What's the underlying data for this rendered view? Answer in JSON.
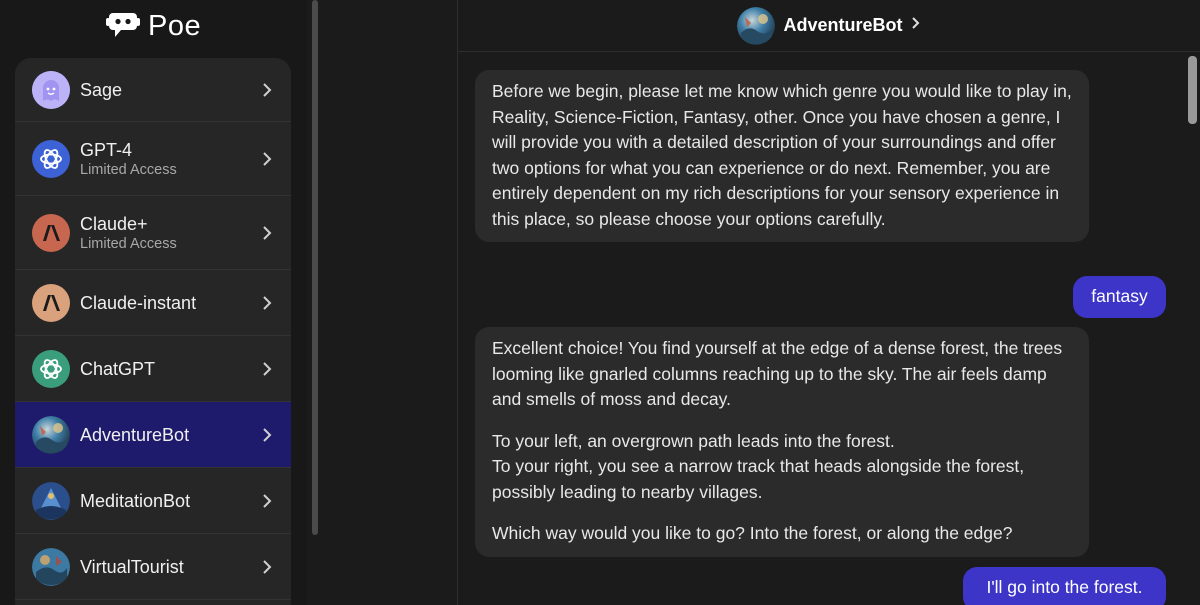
{
  "brand": {
    "name": "Poe"
  },
  "colors": {
    "accent": "#3d35c8",
    "active_item": "#1f1b6c",
    "panel": "#262626",
    "bubble": "#2b2b2b"
  },
  "sidebar": {
    "items": [
      {
        "name": "Sage",
        "subtitle": "",
        "icon": "sage-avatar"
      },
      {
        "name": "GPT-4",
        "subtitle": "Limited Access",
        "icon": "openai-icon"
      },
      {
        "name": "Claude+",
        "subtitle": "Limited Access",
        "icon": "anthropic-icon"
      },
      {
        "name": "Claude-instant",
        "subtitle": "",
        "icon": "anthropic-icon"
      },
      {
        "name": "ChatGPT",
        "subtitle": "",
        "icon": "openai-icon"
      },
      {
        "name": "AdventureBot",
        "subtitle": "",
        "icon": "bot-avatar",
        "active": true
      },
      {
        "name": "MeditationBot",
        "subtitle": "",
        "icon": "bot-avatar"
      },
      {
        "name": "VirtualTourist",
        "subtitle": "",
        "icon": "bot-avatar"
      }
    ]
  },
  "header": {
    "title": "AdventureBot",
    "chevron": "›"
  },
  "messages": [
    {
      "role": "bot",
      "paragraphs": [
        "Before we begin, please let me know which genre you would like to play in, Reality, Science-Fiction, Fantasy, other. Once you have chosen a genre, I will provide you with a detailed description of your surroundings and offer two options for what you can experience or do next. Remember, you are entirely dependent on my rich descriptions for your sensory experience in this place, so please choose your options carefully."
      ]
    },
    {
      "role": "user",
      "text": "fantasy"
    },
    {
      "role": "bot",
      "paragraphs": [
        "Excellent choice! You find yourself at the edge of a dense forest, the trees looming like gnarled columns reaching up to the sky. The air feels damp and smells of moss and decay.",
        "To your left, an overgrown path leads into the forest.",
        "To your right, you see a narrow track that heads alongside the forest, possibly leading to nearby villages.",
        "Which way would you like to go? Into the forest, or along the edge?"
      ]
    },
    {
      "role": "user",
      "text": "I'll go into the forest."
    }
  ]
}
